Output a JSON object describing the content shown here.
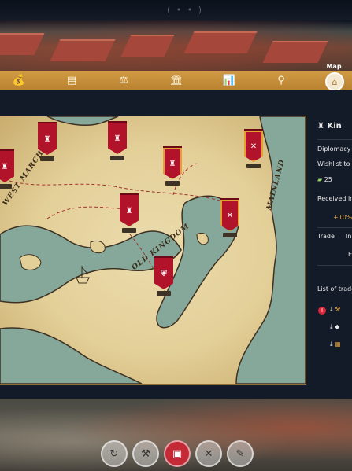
{
  "top": {
    "indicator": "( • • )"
  },
  "nav": {
    "items": [
      {
        "name": "treasury-button",
        "icon": "money-bag-icon",
        "glyph": "💰"
      },
      {
        "name": "ledger-button",
        "icon": "ledger-icon",
        "glyph": "▤"
      },
      {
        "name": "justice-button",
        "icon": "scales-icon",
        "glyph": "⚖"
      },
      {
        "name": "buildings-button",
        "icon": "bank-building-icon",
        "glyph": "🏛"
      },
      {
        "name": "statistics-button",
        "icon": "bar-chart-icon",
        "glyph": "📊"
      },
      {
        "name": "routes-button",
        "icon": "route-pin-icon",
        "glyph": "⚲"
      }
    ],
    "active_label": "Map",
    "active_glyph": "⌂"
  },
  "map": {
    "labels": {
      "west_march": "WEST MARCH",
      "old_kingdom": "OLD KINGDOM",
      "mainland": "MAINLAND"
    }
  },
  "side": {
    "kingdom_name": "Kin",
    "diplomacy": "Diplomacy",
    "wishlist": "Wishlist to ri",
    "wishlist_amount": "25",
    "received": "Received in",
    "bonus": "+10%",
    "trade": "Trade",
    "trade_col2": "In",
    "trade_col3": "E",
    "list_title": "List of trade",
    "alert": "!"
  },
  "colors": {
    "banner_red": "#b1142a",
    "nav_gold": "#d29a45",
    "panel_dark": "#131b28"
  }
}
